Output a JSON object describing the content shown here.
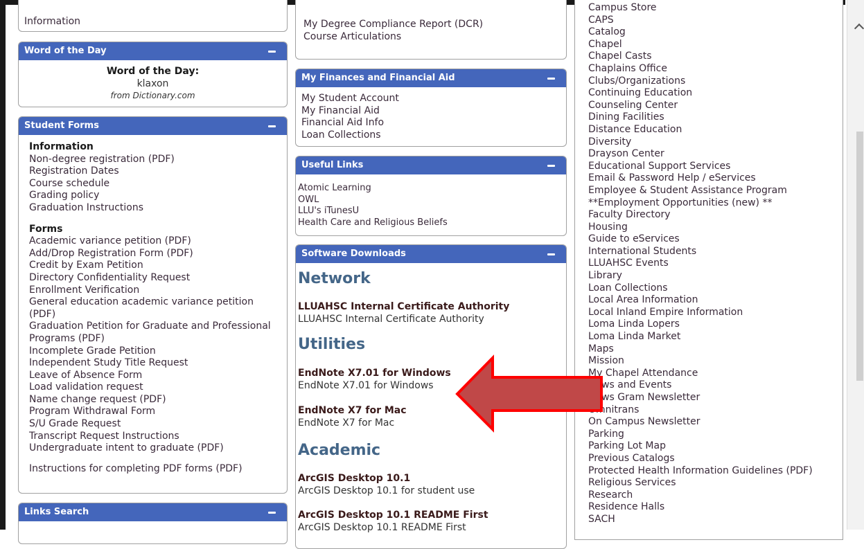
{
  "left": {
    "info_tail": "Information",
    "word_of_day": {
      "header": "Word of the Day",
      "title": "Word of the Day:",
      "word": "klaxon",
      "source": "from Dictionary.com"
    },
    "student_forms": {
      "header": "Student Forms",
      "info_heading": "Information",
      "info_links": [
        "Non-degree registration (PDF)",
        "Registration Dates",
        "Course schedule",
        "Grading policy",
        "Graduation Instructions"
      ],
      "forms_heading": "Forms",
      "form_links": [
        "Academic variance petition (PDF)",
        "Add/Drop Registration Form (PDF)",
        "Credit by Exam Petition",
        "Directory Confidentiality Request",
        "Enrollment Verification",
        "General education academic variance petition",
        "(PDF)",
        "Graduation Petition for Graduate and Professional",
        "Programs (PDF)",
        "Incomplete Grade Petition",
        "Independent Study Title Request",
        "Leave of Absence Form",
        "Load validation request",
        "Name change request (PDF)",
        "Program Withdrawal Form",
        "S/U Grade Request",
        "Transcript Request Instructions",
        "Undergraduate intent to graduate (PDF)"
      ],
      "instructions": "Instructions for completing PDF forms (PDF)"
    },
    "links_search": {
      "header": "Links Search"
    }
  },
  "middle": {
    "top_links": [
      "My Degree Compliance Report (DCR)",
      "Course Articulations"
    ],
    "finances": {
      "header": "My Finances and Financial Aid",
      "links": [
        "My Student Account",
        "My Financial Aid",
        "Financial Aid Info",
        "Loan Collections"
      ]
    },
    "useful_links": {
      "header": "Useful Links",
      "links": [
        "Atomic Learning",
        "OWL",
        "LLU's iTunesU",
        "Health Care and Religious Beliefs"
      ]
    },
    "software": {
      "header": "Software Downloads",
      "network_heading": "Network",
      "cert_title": "LLUAHSC Internal Certificate Authority",
      "cert_sub": "LLUAHSC Internal Certificate Authority",
      "utilities_heading": "Utilities",
      "endnote_win_title": "EndNote X7.01 for Windows",
      "endnote_win_sub": "EndNote X7.01 for Windows",
      "endnote_mac_title": "EndNote X7 for Mac",
      "endnote_mac_sub": "EndNote X7 for Mac",
      "academic_heading": "Academic",
      "arcgis_title": "ArcGIS Desktop 10.1",
      "arcgis_sub": "ArcGIS Desktop 10.1 for student use",
      "arcgis_readme_title": "ArcGIS Desktop 10.1 README First",
      "arcgis_readme_sub": "ArcGIS Desktop 10.1 README First"
    }
  },
  "right": {
    "links": [
      "Campus Store",
      "CAPS",
      "Catalog",
      "Chapel",
      "Chapel Casts",
      "Chaplains Office",
      "Clubs/Organizations",
      "Continuing Education",
      "Counseling Center",
      "Dining Facilities",
      "Distance Education",
      "Diversity",
      "Drayson Center",
      "Educational Support Services",
      "Email & Password Help / eServices",
      "Employee & Student Assistance Program",
      "**Employment Opportunities (new) **",
      "Faculty Directory",
      "Housing",
      "Guide to eServices",
      "International Students",
      "LLUAHSC Events",
      "Library",
      "Loan Collections",
      "Local Area Information",
      "Local Inland Empire Information",
      "Loma Linda Lopers",
      "Loma Linda Market",
      "Maps",
      "Mission",
      "My Chapel Attendance",
      "News and Events",
      "News Gram Newsletter",
      "Omnitrans",
      "On Campus Newsletter",
      "Parking",
      "Parking Lot Map",
      "Previous Catalogs",
      "Protected Health Information Guidelines (PDF)",
      "Religious Services",
      "Research",
      "Residence Halls",
      "SACH"
    ]
  },
  "colors": {
    "panel_header": "#4466bb",
    "arrow_fill": "#c04848",
    "arrow_stroke": "#ff0000",
    "section_heading": "#446688"
  },
  "icons": {
    "minimize": "minus-icon",
    "scroll_up": "chevron-up-icon",
    "arrow": "arrow-left-annotation"
  }
}
